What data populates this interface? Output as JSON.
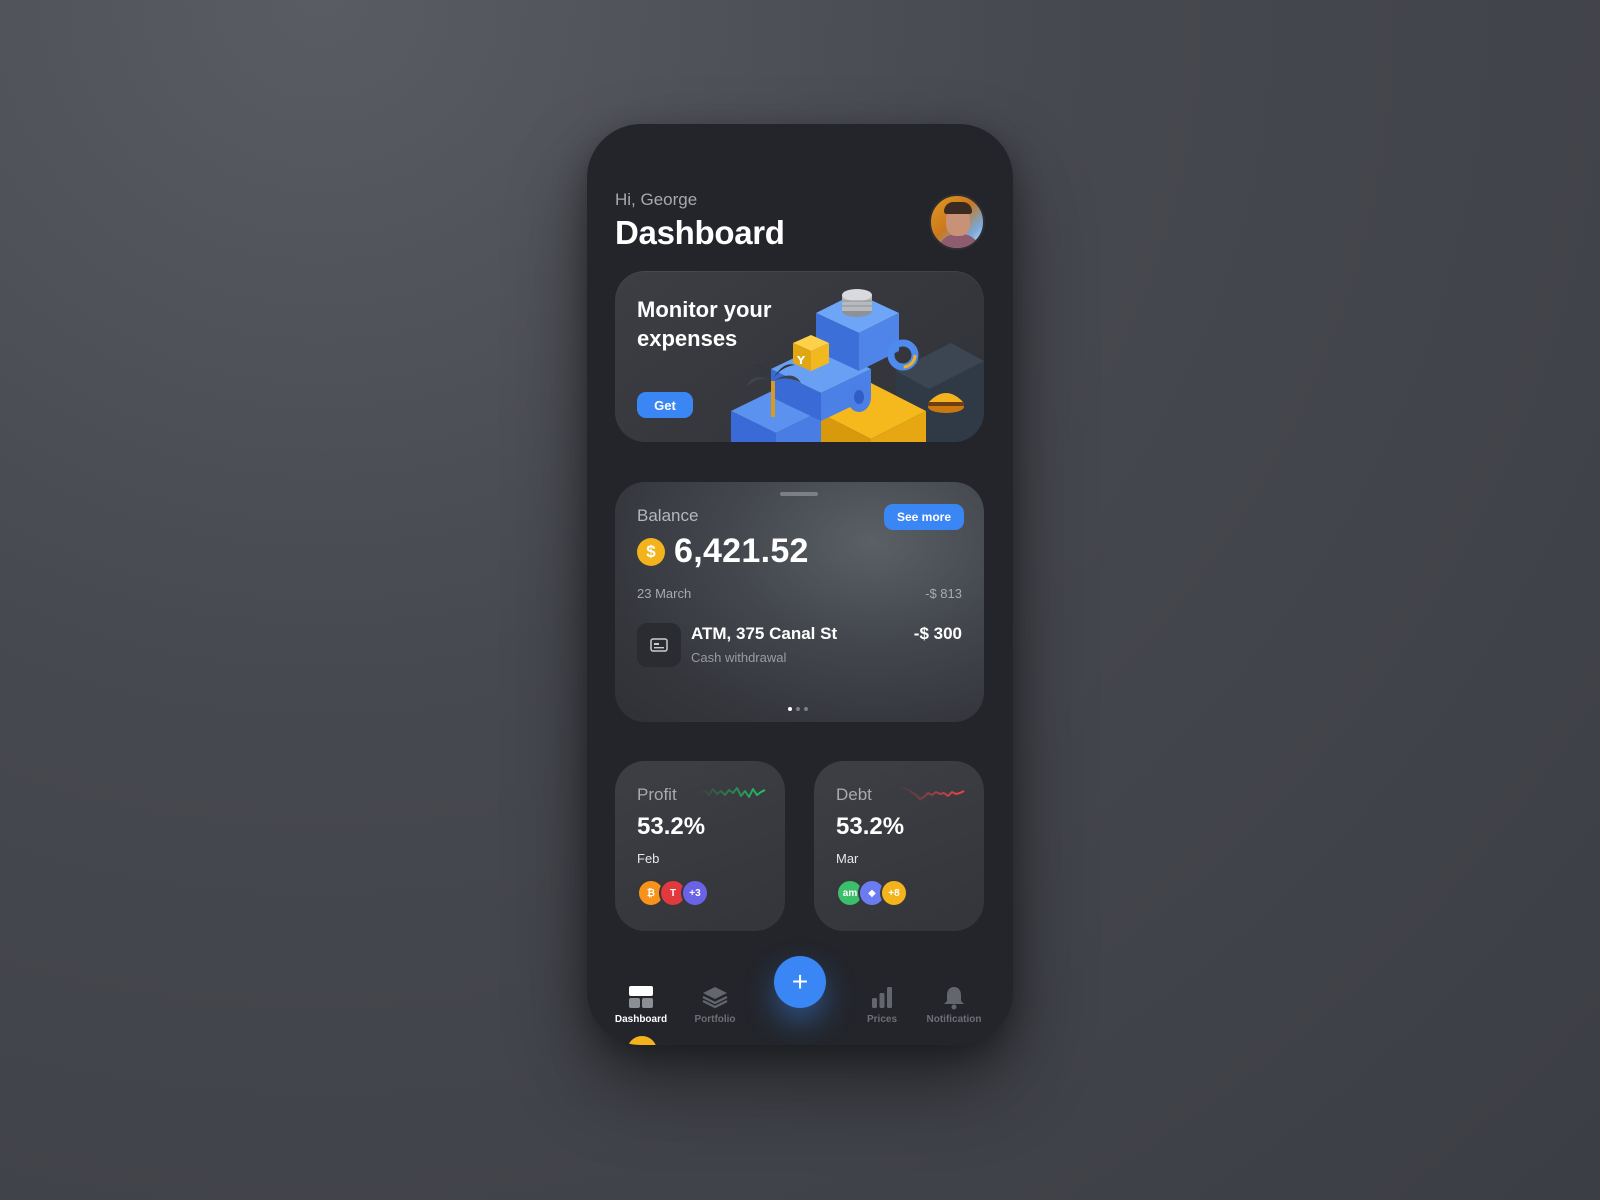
{
  "header": {
    "greeting": "Hi, George",
    "title": "Dashboard"
  },
  "promo": {
    "title": "Monitor your expenses",
    "button_label": "Get"
  },
  "balance": {
    "label": "Balance",
    "see_more_label": "See more",
    "currency_symbol": "$",
    "amount": "6,421.52",
    "date": "23 March",
    "day_delta": "-$ 813",
    "transaction": {
      "name": "ATM, 375 Canal St",
      "subtitle": "Cash withdrawal",
      "amount": "-$ 300"
    },
    "pager": {
      "count": 3,
      "active": 0
    }
  },
  "stats": [
    {
      "label": "Profit",
      "value": "53.2%",
      "month": "Feb",
      "trend_color": "#22c55e",
      "chips": [
        {
          "icon": "bitcoin-icon",
          "glyph": "₿",
          "color": "#f7931a"
        },
        {
          "icon": "tesla-icon",
          "glyph": "T",
          "color": "#e0393e"
        },
        {
          "icon": "more-count",
          "glyph": "+3",
          "color": "#6b63e6"
        }
      ]
    },
    {
      "label": "Debt",
      "value": "53.2%",
      "month": "Mar",
      "trend_color": "#ef4444",
      "chips": [
        {
          "icon": "amc-icon",
          "glyph": "am",
          "color": "#3bbf6a"
        },
        {
          "icon": "ethereum-icon",
          "glyph": "◆",
          "color": "#6b7cf0"
        },
        {
          "icon": "more-count",
          "glyph": "+8",
          "color": "#f2b31c"
        }
      ]
    }
  ],
  "nav": {
    "items": [
      {
        "label": "Dashboard",
        "icon": "dashboard-icon",
        "active": true
      },
      {
        "label": "Portfolio",
        "icon": "layers-icon",
        "active": false
      },
      {
        "label": "Prices",
        "icon": "bar-chart-icon",
        "active": false
      },
      {
        "label": "Notification",
        "icon": "bell-icon",
        "active": false
      }
    ],
    "fab_icon": "plus-icon",
    "fab_glyph": "+"
  },
  "colors": {
    "accent": "#3a86f4",
    "coin": "#f2b31c",
    "phone_bg": "#23252a",
    "card_bg": "#3a3c42"
  }
}
